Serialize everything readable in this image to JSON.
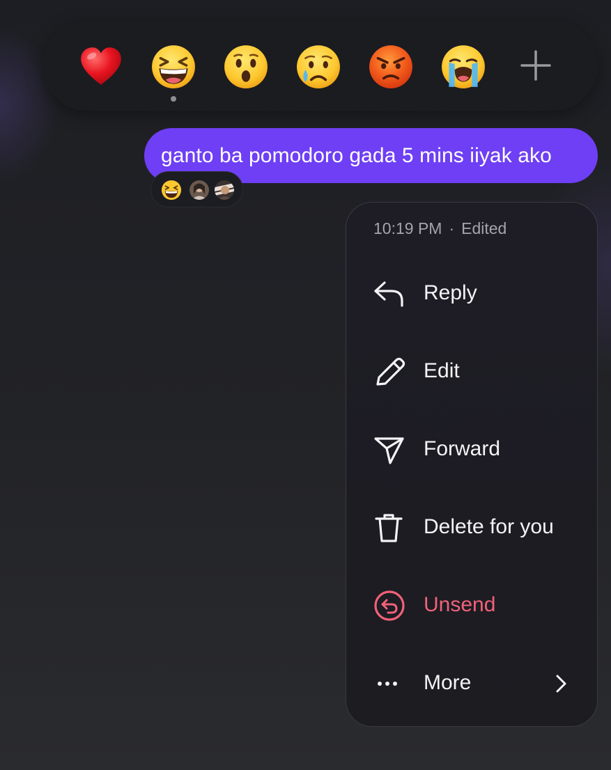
{
  "reaction_bar": {
    "reactions": [
      {
        "name": "red-heart",
        "glyph": "❤️"
      },
      {
        "name": "grinning-squinting-face",
        "glyph": "😆",
        "selected": true
      },
      {
        "name": "hushed-face",
        "glyph": "😮"
      },
      {
        "name": "crying-face",
        "glyph": "😢"
      },
      {
        "name": "angry-face",
        "glyph": "😡"
      },
      {
        "name": "loudly-crying-face",
        "glyph": "😭"
      }
    ],
    "more_icon": "plus-icon"
  },
  "message": {
    "text": "ganto ba pomodoro gada 5 mins iiyak ako",
    "bubble_color": "#6e3ff4"
  },
  "reaction_summary": {
    "emoji": "grinning-squinting-face",
    "reactor_avatars": [
      "avatar-1",
      "avatar-2"
    ]
  },
  "menu": {
    "time": "10:19 PM",
    "separator": "·",
    "status": "Edited",
    "items": [
      {
        "label": "Reply",
        "icon": "reply-arrow-icon"
      },
      {
        "label": "Edit",
        "icon": "pencil-icon"
      },
      {
        "label": "Forward",
        "icon": "paper-plane-icon"
      },
      {
        "label": "Delete for you",
        "icon": "trash-icon"
      },
      {
        "label": "Unsend",
        "icon": "unsend-icon",
        "color": "#f1617a"
      },
      {
        "label": "More",
        "icon": "ellipsis-icon",
        "trailing_icon": "chevron-right-icon"
      }
    ]
  },
  "colors": {
    "background": "#222327",
    "menu_background": "#1d1d23",
    "danger": "#f1617a",
    "meta_text": "#a4a4ab"
  }
}
